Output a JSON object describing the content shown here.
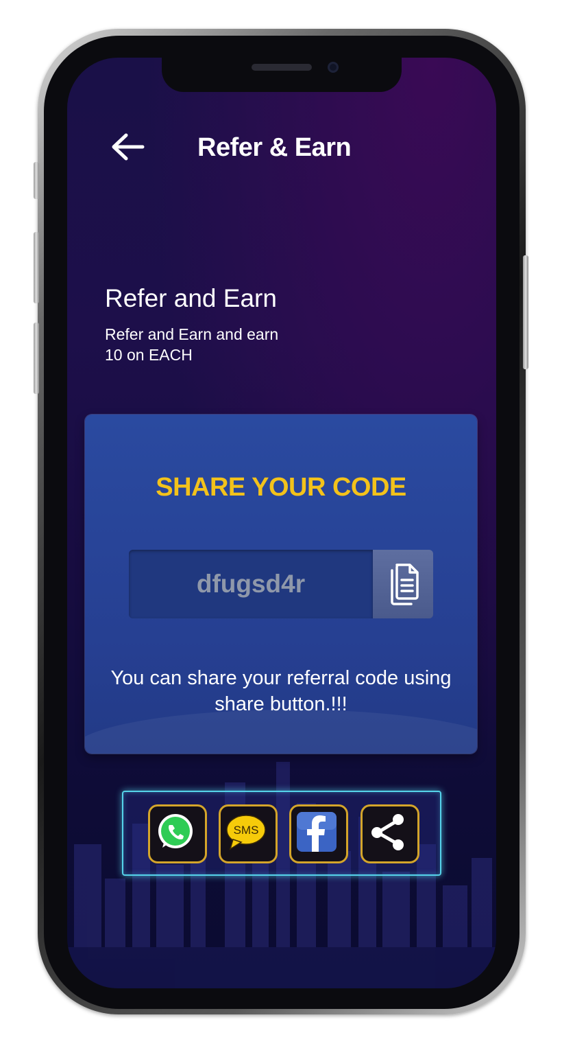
{
  "header": {
    "title": "Refer & Earn",
    "back_icon": "back-arrow-icon"
  },
  "hero": {
    "title": "Refer and Earn",
    "subtitle": "Refer and Earn and earn 10 on EACH"
  },
  "card": {
    "title": "SHARE YOUR CODE",
    "code": "dfugsd4r",
    "copy_icon": "copy-icon",
    "note": "You can share your referral code using share button.!!!"
  },
  "share_buttons": [
    {
      "name": "whatsapp",
      "icon": "whatsapp-icon"
    },
    {
      "name": "sms",
      "icon": "sms-icon",
      "label": "SMS"
    },
    {
      "name": "facebook",
      "icon": "facebook-icon"
    },
    {
      "name": "share",
      "icon": "share-icon"
    }
  ],
  "colors": {
    "accent_yellow": "#f3c21b",
    "card_blue": "#263f91",
    "glow_cyan": "#55d3ea",
    "button_border_gold": "#d4a52a"
  }
}
